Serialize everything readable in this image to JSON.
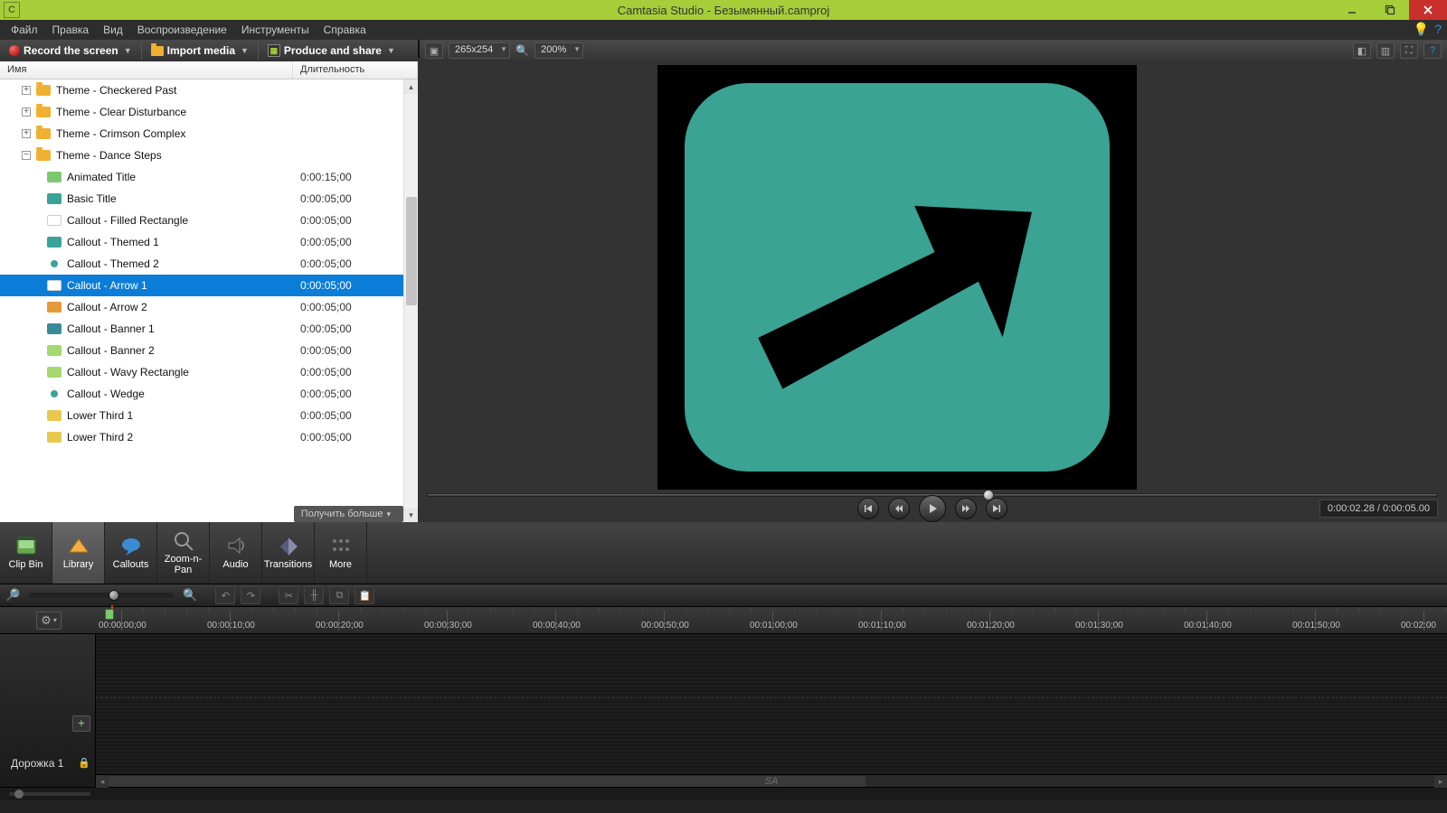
{
  "window": {
    "title": "Camtasia Studio - Безымянный.camproj"
  },
  "menu": {
    "items": [
      "Файл",
      "Правка",
      "Вид",
      "Воспроизведение",
      "Инструменты",
      "Справка"
    ]
  },
  "actions": {
    "record": "Record the screen",
    "import": "Import media",
    "produce": "Produce and share"
  },
  "previewBar": {
    "dimensions": "265x254",
    "zoom": "200%"
  },
  "library": {
    "columns": {
      "name": "Имя",
      "duration": "Длительность"
    },
    "themes": [
      {
        "label": "Theme - Checkered Past",
        "expanded": false
      },
      {
        "label": "Theme - Clear Disturbance",
        "expanded": false
      },
      {
        "label": "Theme - Crimson Complex",
        "expanded": false
      },
      {
        "label": "Theme - Dance Steps",
        "expanded": true
      }
    ],
    "assets": [
      {
        "label": "Animated Title",
        "dur": "0:00:15;00",
        "cls": "green"
      },
      {
        "label": "Basic Title",
        "dur": "0:00:05;00",
        "cls": "teal"
      },
      {
        "label": "Callout - Filled Rectangle",
        "dur": "0:00:05;00",
        "cls": "white"
      },
      {
        "label": "Callout - Themed 1",
        "dur": "0:00:05;00",
        "cls": "teal"
      },
      {
        "label": "Callout - Themed 2",
        "dur": "0:00:05;00",
        "cls": "dot"
      },
      {
        "label": "Callout - Arrow 1",
        "dur": "0:00:05;00",
        "cls": "white",
        "selected": true
      },
      {
        "label": "Callout - Arrow 2",
        "dur": "0:00:05;00",
        "cls": "orange"
      },
      {
        "label": "Callout - Banner 1",
        "dur": "0:00:05;00",
        "cls": "tealdark"
      },
      {
        "label": "Callout - Banner 2",
        "dur": "0:00:05;00",
        "cls": "lime"
      },
      {
        "label": "Callout - Wavy Rectangle",
        "dur": "0:00:05;00",
        "cls": "lime"
      },
      {
        "label": "Callout - Wedge",
        "dur": "0:00:05;00",
        "cls": "dot"
      },
      {
        "label": "Lower Third 1",
        "dur": "0:00:05;00",
        "cls": "yellow"
      },
      {
        "label": "Lower Third 2",
        "dur": "0:00:05;00",
        "cls": "yellow"
      }
    ],
    "get_more": "Получить больше"
  },
  "playback": {
    "timecode": "0:00:02.28 / 0:00:05.00"
  },
  "tooltabs": {
    "items": [
      {
        "label": "Clip Bin"
      },
      {
        "label": "Library",
        "active": true
      },
      {
        "label": "Callouts"
      },
      {
        "label": "Zoom-n-Pan"
      },
      {
        "label": "Audio"
      },
      {
        "label": "Transitions"
      },
      {
        "label": "More"
      }
    ]
  },
  "timeline": {
    "ticks": [
      "00:00:00;00",
      "00:00:10;00",
      "00:00:20;00",
      "00:00:30;00",
      "00:00:40;00",
      "00:00:50;00",
      "00:01:00;00",
      "00:01:10;00",
      "00:01:20;00",
      "00:01:30;00",
      "00:01:40;00",
      "00:01:50;00",
      "00:02:00"
    ],
    "track1": "Дорожка 1",
    "sa": "SA"
  }
}
